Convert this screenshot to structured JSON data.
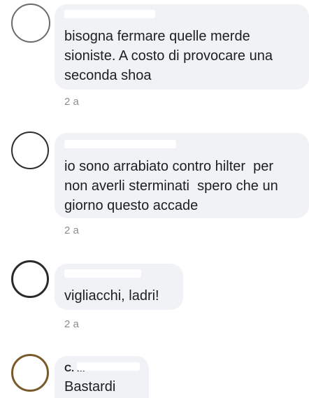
{
  "comments": [
    {
      "text": "bisogna fermare quelle merde\nsioniste. A costo di provocare una\nseconda shoa",
      "time": "2 a"
    },
    {
      "text": "io sono arrabiato contro hilter  per\nnon averli sterminati  spero che un\ngiorno questo accade",
      "time": "2 a"
    },
    {
      "text": "vigliacchi, ladri!",
      "time": "2 a"
    },
    {
      "name_fragment": "C.  M",
      "text": "Bastardi"
    }
  ]
}
